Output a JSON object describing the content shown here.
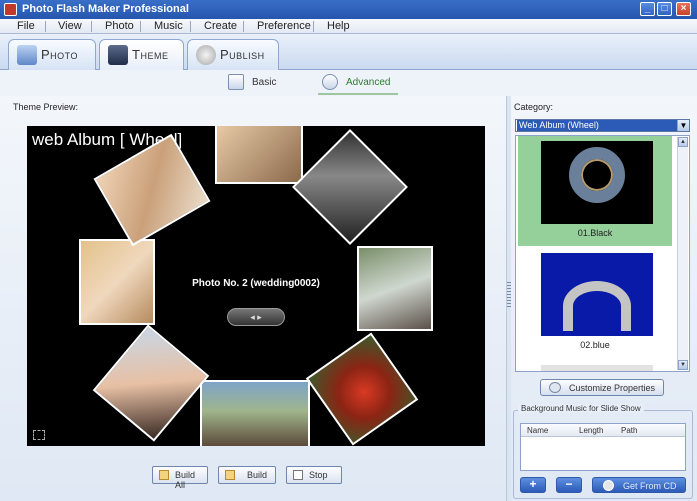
{
  "window": {
    "title": "Photo Flash Maker Professional",
    "minimize": "_",
    "maximize": "□",
    "close": "×"
  },
  "menu": [
    "File",
    "View",
    "Photo",
    "Music",
    "Create",
    "Preference",
    "Help"
  ],
  "main_tabs": [
    {
      "label": "Photo",
      "icon": "photo-icon",
      "active": false
    },
    {
      "label": "Theme",
      "icon": "theme-icon",
      "active": true
    },
    {
      "label": "Publish",
      "icon": "publish-icon",
      "active": false
    }
  ],
  "sub_tabs": [
    {
      "label": "Basic",
      "active": false
    },
    {
      "label": "Advanced",
      "active": true
    }
  ],
  "preview": {
    "label": "Theme Preview:",
    "album_title": "web Album [ Wheel]",
    "caption": "Photo No. 2 (wedding0002)"
  },
  "bottom_buttons": {
    "build_all": "Build All",
    "build": "Build",
    "stop": "Stop"
  },
  "category": {
    "label": "Category:",
    "selected": "Web Album (Wheel)",
    "themes": [
      {
        "name": "01.Black",
        "selected": true,
        "color": "#000000"
      },
      {
        "name": "02.blue",
        "selected": false,
        "color": "#0a1aa8"
      }
    ]
  },
  "customize_button": "Customize Properties",
  "music": {
    "group_title": "Background Music for Slide Show",
    "columns": [
      "Name",
      "Length",
      "Path"
    ],
    "add": "+",
    "remove": "−",
    "cd_button": "Get From CD"
  },
  "colors": {
    "titlebar": "#2a5db3",
    "selected_theme": "#95cf9a",
    "combo_selection": "#2b5bb6"
  }
}
